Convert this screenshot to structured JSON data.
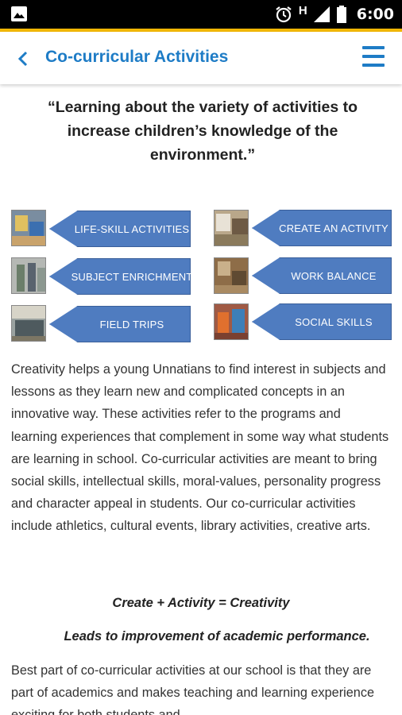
{
  "status_bar": {
    "time": "6:00",
    "network": "H"
  },
  "app_bar": {
    "title": "Co-curricular Activities"
  },
  "quote": "“Learning about the variety of activities to increase children’s knowledge of the environment.”",
  "activities_left": [
    {
      "label": "LIFE-SKILL  ACTIVITIES"
    },
    {
      "label": "SUBJECT ENRICHMENT"
    },
    {
      "label": "FIELD TRIPS"
    }
  ],
  "activities_right": [
    {
      "label": "CREATE AN ACTIVITY"
    },
    {
      "label": "WORK BALANCE"
    },
    {
      "label": "SOCIAL SKILLS"
    }
  ],
  "paragraph_1": "Creativity helps a young Unnatians to find interest in subjects and lessons as they learn new and complicated concepts in an innovative way. These activities refer to the programs and learning experiences that complement in some way what students are learning in school. Co-curricular activities are meant to bring social skills, intellectual skills, moral-values, personality progress and character appeal in students. Our co-curricular activities include athletics, cultural events, library activities, creative arts.",
  "formula": "Create + Activity = Creativity",
  "formula_sub": "Leads to improvement of academic performance.",
  "paragraph_2": "Best part of co-curricular activities at our school is that they are part of academics and makes teaching and learning experience exciting for both students and",
  "colors": {
    "accent": "#1e7cc6",
    "arrow": "#4f7cc0",
    "status_line": "#f2b705"
  }
}
